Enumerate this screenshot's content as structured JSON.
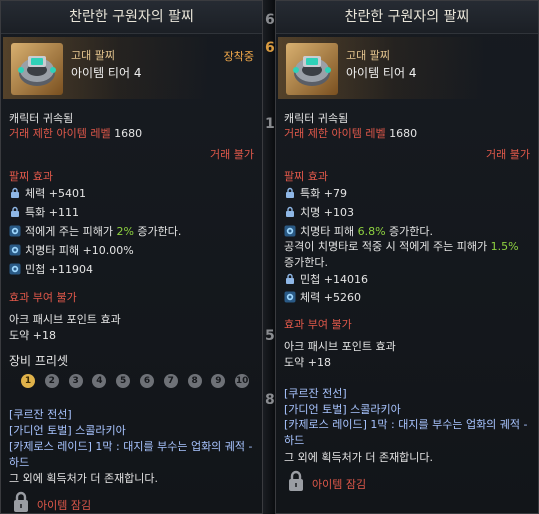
{
  "left": {
    "title": "찬란한 구원자의 팔찌",
    "grade": "고대 팔찌",
    "tier": "아이템 티어 4",
    "equipped": "장착중",
    "bound": "캐릭터 귀속됨",
    "level_label": "거래 제한 아이템 레벨",
    "level_value": "1680",
    "trade": "거래 불가",
    "effects_title": "팔찌 효과",
    "stats": [
      {
        "icon": "lock-icon",
        "text": "체력 +5401"
      },
      {
        "icon": "lock-icon",
        "text": "특화 +111"
      }
    ],
    "effect1_pre": "적에게 주는 피해가 ",
    "effect1_val": "2%",
    "effect1_post": " 증가한다.",
    "effect2": "치명타 피해 +10.00%",
    "effect3": "민첩 +11904",
    "grant": "효과 부여 불가",
    "ark_title": "아크 패시브 포인트 효과",
    "ark_value": "도약 +18",
    "preset_title": "장비 프리셋",
    "presets": [
      "1",
      "2",
      "3",
      "4",
      "5",
      "6",
      "7",
      "8",
      "9",
      "10"
    ],
    "sources": [
      "[쿠르잔 전선]",
      "[가디언 토벌] 스콜라키아",
      "[카제로스 레이드] 1막 : 대지를 부수는 업화의 궤적 -",
      "하드"
    ],
    "more": "그 외에 획득처가 더 존재합니다.",
    "locked": "아이템 잠김"
  },
  "right": {
    "title": "찬란한 구원자의 팔찌",
    "grade": "고대 팔찌",
    "tier": "아이템 티어 4",
    "bound": "캐릭터 귀속됨",
    "level_label": "거래 제한 아이템 레벨",
    "level_value": "1680",
    "trade": "거래 불가",
    "effects_title": "팔찌 효과",
    "stats": [
      {
        "icon": "lock-icon",
        "text": "특화 +79"
      },
      {
        "icon": "lock-icon",
        "text": "치명 +103"
      }
    ],
    "effect1_pre": "치명타 피해 ",
    "effect1_val": "6.8%",
    "effect1_post": " 증가한다.",
    "effect2_pre": "공격이 치명타로 적중 시 적에게 주는 피해가 ",
    "effect2_val": "1.5%",
    "effect2_post": " 증가한다.",
    "stats2": [
      {
        "icon": "lock-icon",
        "text": "민첩 +14016"
      },
      {
        "icon": "gem-icon",
        "text": "체력 +5260"
      }
    ],
    "grant": "효과 부여 불가",
    "ark_title": "아크 패시브 포인트 효과",
    "ark_value": "도약 +18",
    "sources": [
      "[쿠르잔 전선]",
      "[가디언 토벌] 스콜라키아",
      "[카제로스 레이드] 1막 : 대지를 부수는 업화의 궤적 -",
      "하드"
    ],
    "more": "그 외에 획득처가 더 존재합니다.",
    "locked": "아이템 잠김"
  },
  "seam_glyphs": [
    "6",
    "6",
    "1(",
    "5",
    "8"
  ],
  "colors": {
    "red": "#e0584a",
    "green": "#8ed140",
    "source_blue": "#a8c4ff",
    "equipped": "#f2a94a",
    "active_preset": "#e0b24a"
  }
}
